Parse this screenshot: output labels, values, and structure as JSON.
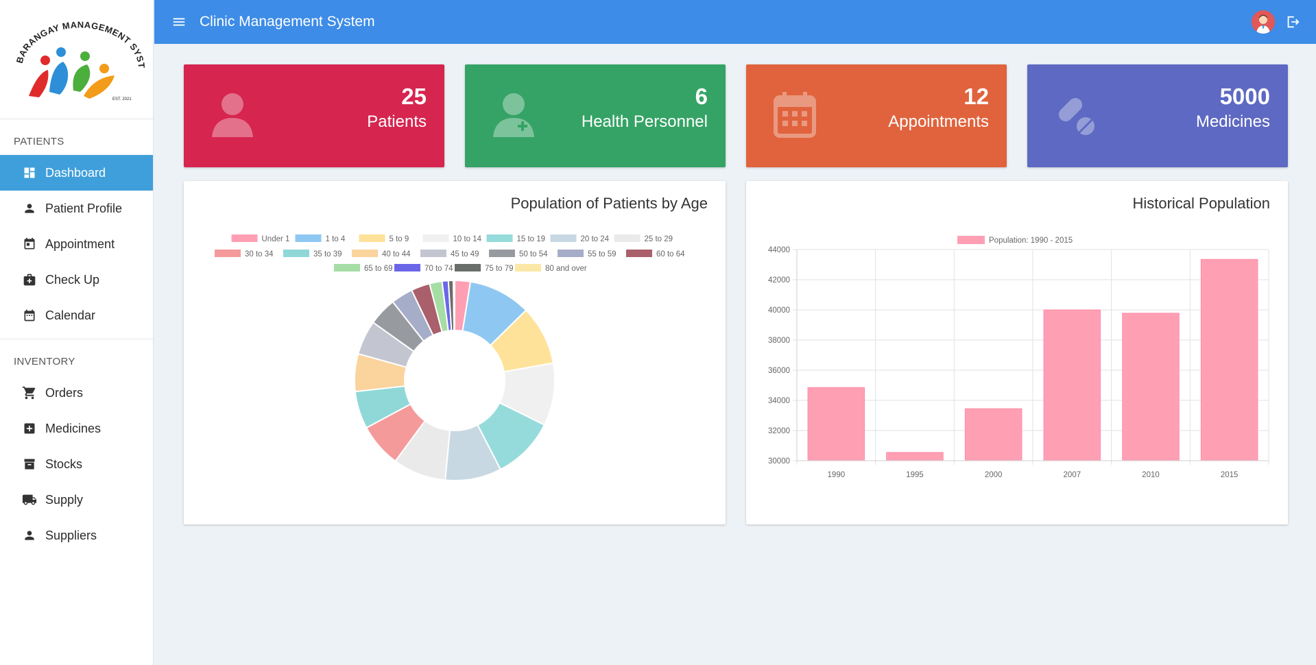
{
  "app": {
    "title": "Clinic Management System"
  },
  "logo": {
    "text": "BARANGAY MANAGEMENT SYSTEM",
    "small_text": "EST. 2021"
  },
  "sidebar": {
    "patients_title": "PATIENTS",
    "patients_items": [
      {
        "label": "Dashboard",
        "icon": "dashboard-icon",
        "active": true
      },
      {
        "label": "Patient Profile",
        "icon": "person-icon"
      },
      {
        "label": "Appointment",
        "icon": "calendar-check-icon"
      },
      {
        "label": "Check Up",
        "icon": "medical-bag-icon"
      },
      {
        "label": "Calendar",
        "icon": "calendar-icon"
      }
    ],
    "inventory_title": "INVENTORY",
    "inventory_items": [
      {
        "label": "Orders",
        "icon": "cart-icon"
      },
      {
        "label": "Medicines",
        "icon": "medical-plus-icon"
      },
      {
        "label": "Stocks",
        "icon": "archive-icon"
      },
      {
        "label": "Supply",
        "icon": "truck-icon"
      },
      {
        "label": "Suppliers",
        "icon": "person-icon"
      }
    ]
  },
  "stats": [
    {
      "value": "25",
      "label": "Patients",
      "icon": "user-icon",
      "color": "#d6254f"
    },
    {
      "value": "6",
      "label": "Health Personnel",
      "icon": "doctor-icon",
      "color": "#35a365"
    },
    {
      "value": "12",
      "label": "Appointments",
      "icon": "calendar-icon",
      "color": "#e0633d"
    },
    {
      "value": "5000",
      "label": "Medicines",
      "icon": "pills-icon",
      "color": "#5d69c2"
    }
  ],
  "chart_data": [
    {
      "type": "pie",
      "title": "Population of Patients by Age",
      "categories": [
        "Under 1",
        "1 to 4",
        "5 to 9",
        "10 to 14",
        "15 to 19",
        "20 to 24",
        "25 to 29",
        "30 to 34",
        "35 to 39",
        "40 to 44",
        "45 to 49",
        "50 to 54",
        "55 to 59",
        "60 to 64",
        "65 to 69",
        "70 to 74",
        "75 to 79",
        "80 and over"
      ],
      "values": [
        2.5,
        10,
        9.5,
        10,
        10,
        9,
        8.5,
        7,
        6,
        6,
        5.5,
        4.5,
        3.5,
        3,
        2,
        1,
        0.8,
        0.2
      ],
      "colors": [
        "#ff9fb4",
        "#8ec8f2",
        "#ffe29a",
        "#f0f0f0",
        "#96dbdb",
        "#c8d8e3",
        "#eaeaea",
        "#f59a9a",
        "#90d8d8",
        "#fad39d",
        "#c3c6d1",
        "#979ba0",
        "#a6adc8",
        "#a9606b",
        "#a5dda5",
        "#6b66e8",
        "#6a6e6a",
        "#fbe8a6"
      ],
      "legend": "top",
      "doughnut": true
    },
    {
      "type": "bar",
      "title": "Historical Population",
      "series": [
        {
          "name": "Population: 1990 - 2015",
          "values": [
            34850,
            30550,
            33450,
            40000,
            39780,
            43350
          ],
          "color": "#ff9fb4"
        }
      ],
      "categories": [
        "1990",
        "1995",
        "2000",
        "2007",
        "2010",
        "2015"
      ],
      "ylim": [
        30000,
        44000
      ],
      "yticks": [
        30000,
        32000,
        34000,
        36000,
        38000,
        40000,
        42000,
        44000
      ],
      "legend": "top",
      "grid": true
    }
  ]
}
